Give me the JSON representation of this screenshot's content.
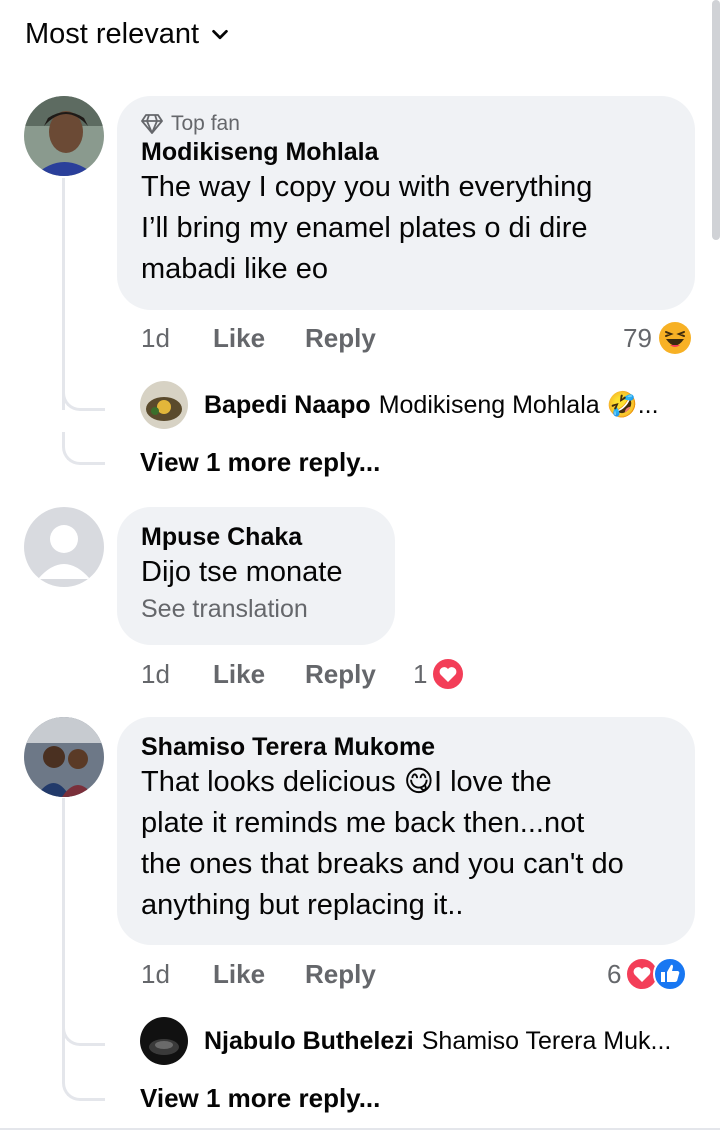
{
  "sort": {
    "label": "Most relevant"
  },
  "comments": [
    {
      "badge": "Top fan",
      "name": "Modikiseng Mohlala",
      "lines": [
        "The way I copy you with everything",
        "I’ll bring my enamel plates o di dire",
        "mabadi like eo"
      ],
      "time": "1d",
      "like": "Like",
      "reply": "Reply",
      "reaction_count": "79",
      "reply_preview": {
        "name": "Bapedi Naapo",
        "text": "Modikiseng Mohlala 🤣..."
      },
      "more_replies": "View 1 more reply..."
    },
    {
      "name": "Mpuse Chaka",
      "lines": [
        "Dijo tse monate"
      ],
      "see_translation": "See translation",
      "time": "1d",
      "like": "Like",
      "reply": "Reply",
      "reaction_count": "1"
    },
    {
      "name": "Shamiso Terera Mukome",
      "lines": [
        "That looks delicious 😋I love the",
        "plate it reminds me back then...not",
        "the ones that breaks and you can't do",
        "anything but replacing it.."
      ],
      "time": "1d",
      "like": "Like",
      "reply": "Reply",
      "reaction_count": "6",
      "reply_preview": {
        "name": "Njabulo Buthelezi",
        "text": "Shamiso Terera Muk..."
      },
      "more_replies": "View 1 more reply..."
    }
  ],
  "colors": {
    "like_blue": "#1877f2",
    "love_red": "#f33e58",
    "haha_yellow": "#f7b125",
    "bubble_bg": "#f0f2f5"
  }
}
